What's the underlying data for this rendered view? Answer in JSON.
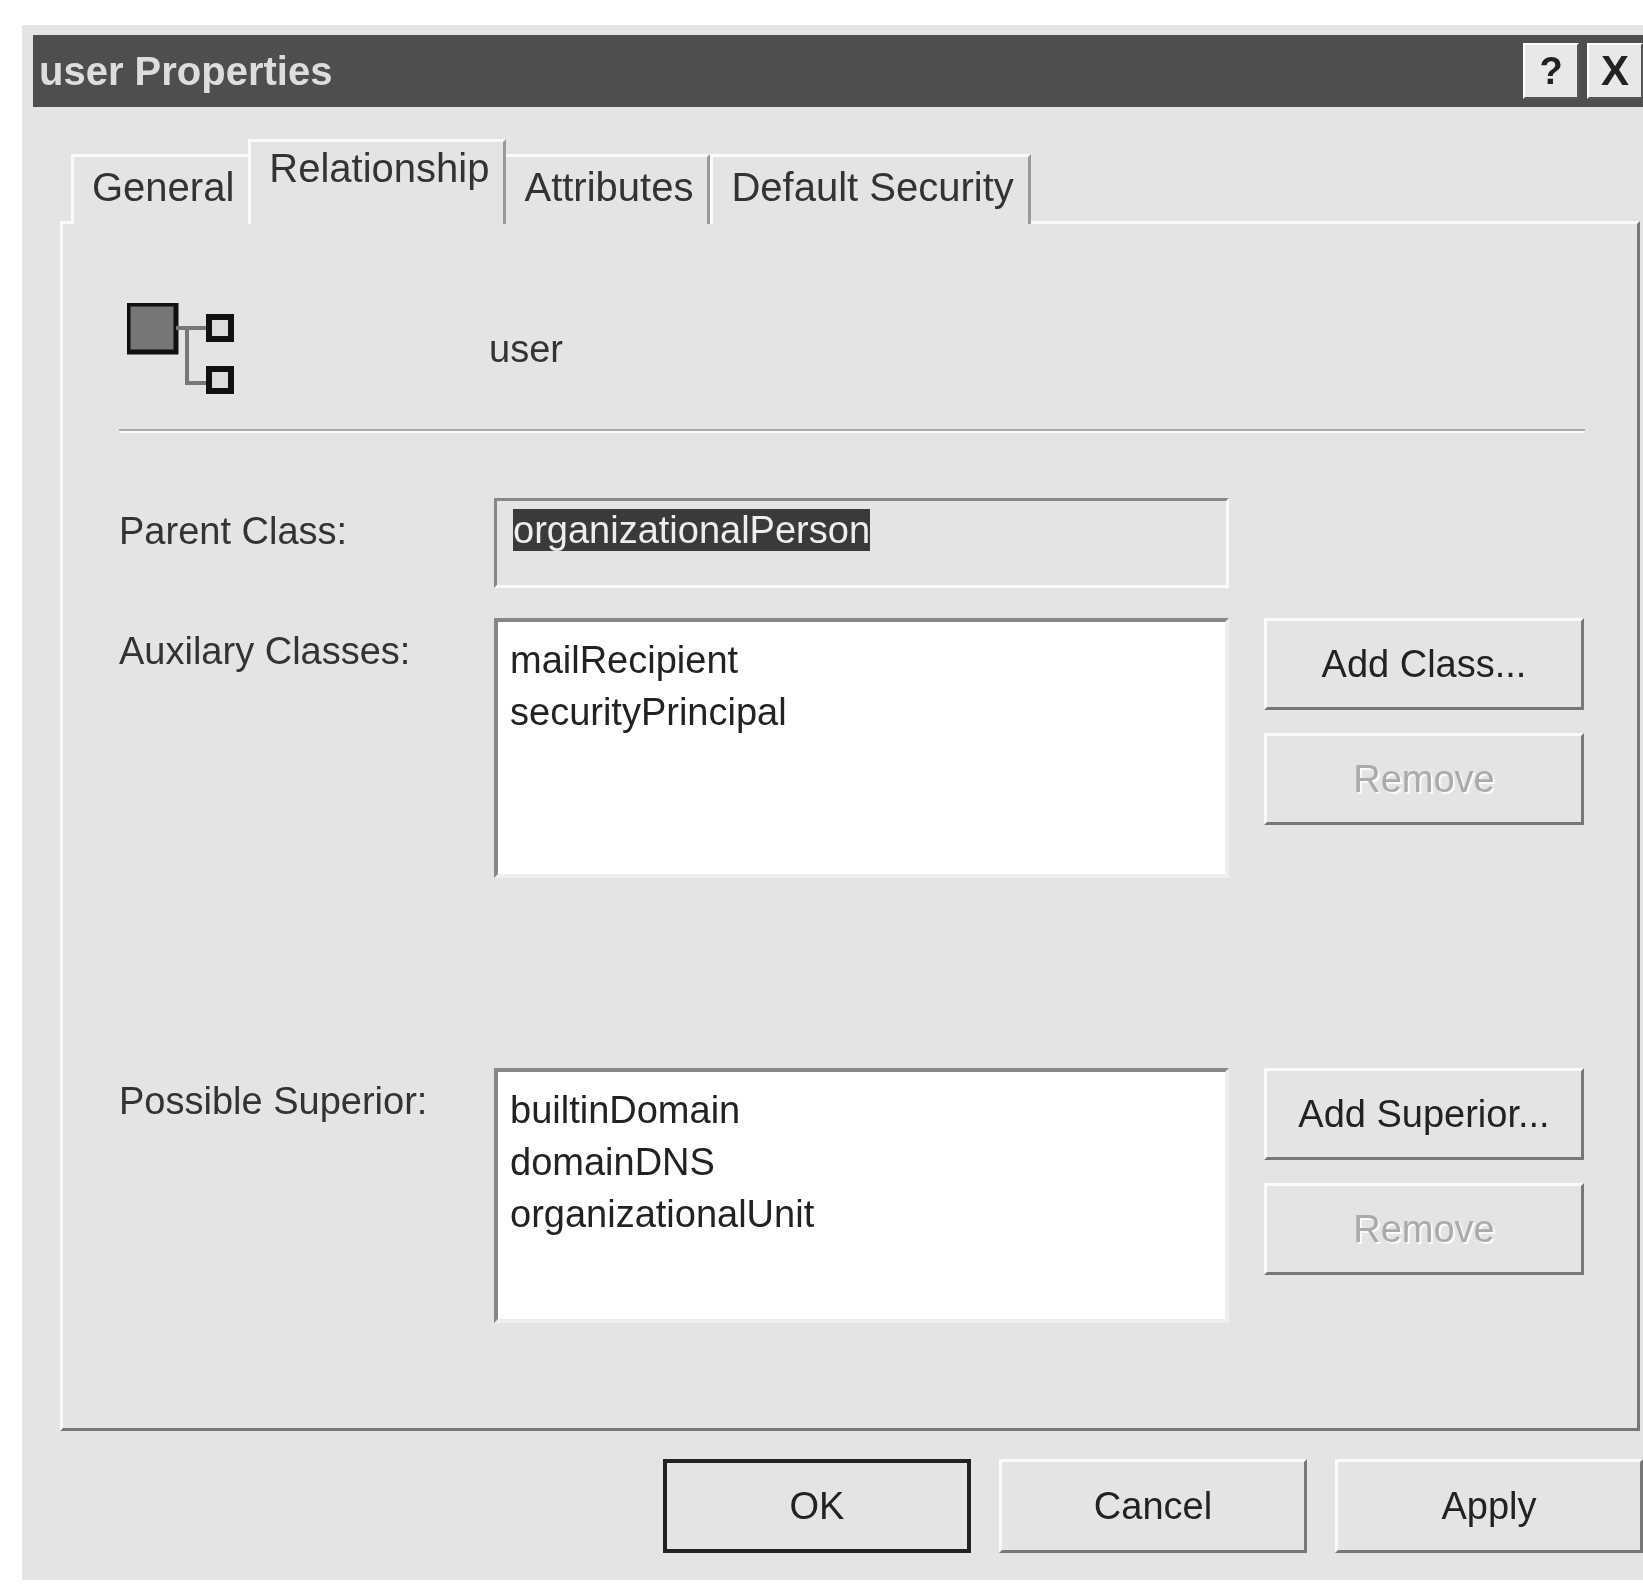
{
  "window": {
    "title": "user Properties",
    "title_buttons": [
      {
        "kind": "help",
        "label": "?"
      },
      {
        "kind": "close",
        "label": "X"
      }
    ]
  },
  "tabs": [
    {
      "label": "General",
      "selected": false
    },
    {
      "label": "Relationship",
      "selected": true
    },
    {
      "label": "Attributes",
      "selected": false
    },
    {
      "label": "Default Security",
      "selected": false
    }
  ],
  "header": {
    "class_name": "user"
  },
  "parent_class": {
    "label": "Parent Class:",
    "value": "organizationalPerson",
    "text_selected": true
  },
  "auxiliary_classes": {
    "label": "Auxilary Classes:",
    "items": [
      "mailRecipient",
      "securityPrincipal"
    ],
    "buttons": [
      {
        "label": "Add Class...",
        "disabled": false
      },
      {
        "label": "Remove",
        "disabled": true
      }
    ]
  },
  "possible_superior": {
    "label": "Possible Superior:",
    "items": [
      "builtinDomain",
      "domainDNS",
      "organizationalUnit"
    ],
    "buttons": [
      {
        "label": "Add Superior...",
        "disabled": false
      },
      {
        "label": "Remove",
        "disabled": true
      }
    ]
  },
  "buttons": [
    {
      "label": "OK",
      "default": true
    },
    {
      "label": "Cancel",
      "default": false
    },
    {
      "label": "Apply",
      "default": false
    }
  ]
}
